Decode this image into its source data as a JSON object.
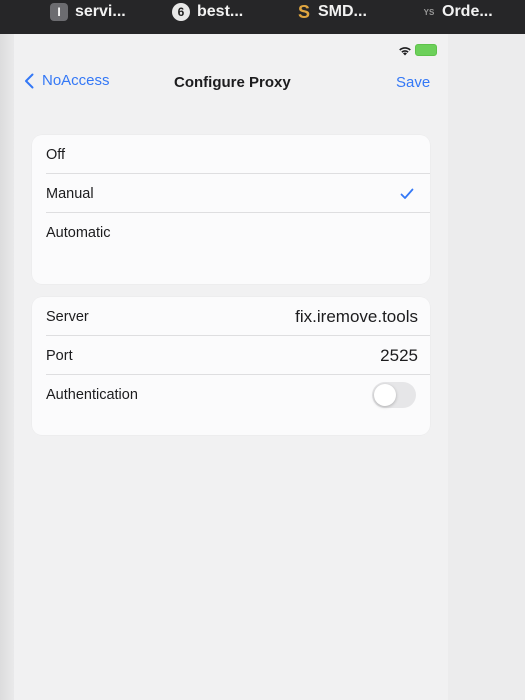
{
  "tabs": [
    {
      "label": "servi...",
      "icon": "I"
    },
    {
      "label": "best...",
      "icon": "6"
    },
    {
      "label": "SMD...",
      "icon": "S"
    },
    {
      "label": "Orde...",
      "icon": "YS"
    }
  ],
  "colors": {
    "accent": "#3478f6",
    "battery": "#6cd05a"
  },
  "nav": {
    "back_label": "NoAccess",
    "title": "Configure Proxy",
    "save_label": "Save"
  },
  "proxy_mode": {
    "options": [
      {
        "label": "Off",
        "selected": false
      },
      {
        "label": "Manual",
        "selected": true
      },
      {
        "label": "Automatic",
        "selected": false
      }
    ]
  },
  "proxy_settings": {
    "server_label": "Server",
    "server_value": "fix.iremove.tools",
    "port_label": "Port",
    "port_value": "2525",
    "auth_label": "Authentication",
    "auth_enabled": false
  },
  "icons": {
    "back": "chevron-left-icon",
    "check": "checkmark-icon",
    "wifi": "wifi-icon",
    "battery": "battery-charging-icon"
  }
}
